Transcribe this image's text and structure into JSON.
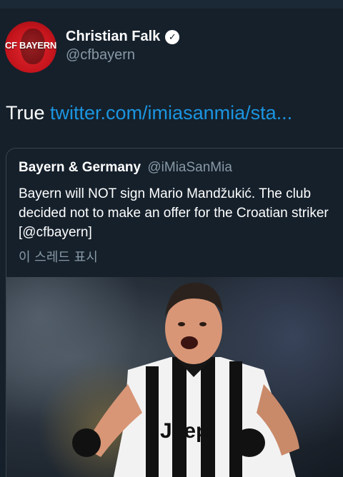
{
  "author": {
    "avatar_text": "CF BAYERN",
    "name": "Christian Falk",
    "handle": "@cfbayern",
    "verified_icon": "verified-badge-icon"
  },
  "tweet": {
    "text": "True",
    "link": "twitter.com/imiasanmia/sta..."
  },
  "quoted_tweet": {
    "name": "Bayern & Germany",
    "handle": "@iMiaSanMia",
    "body": "Bayern will NOT sign Mario Mandžukić. The club decided not to make an offer for the Croatian striker [@cfbayern]",
    "show_thread": "이 스레드 표시",
    "photo_text": "Jeep"
  },
  "colors": {
    "background": "#15202b",
    "link": "#1b95e0",
    "secondary_text": "#8899a6"
  }
}
